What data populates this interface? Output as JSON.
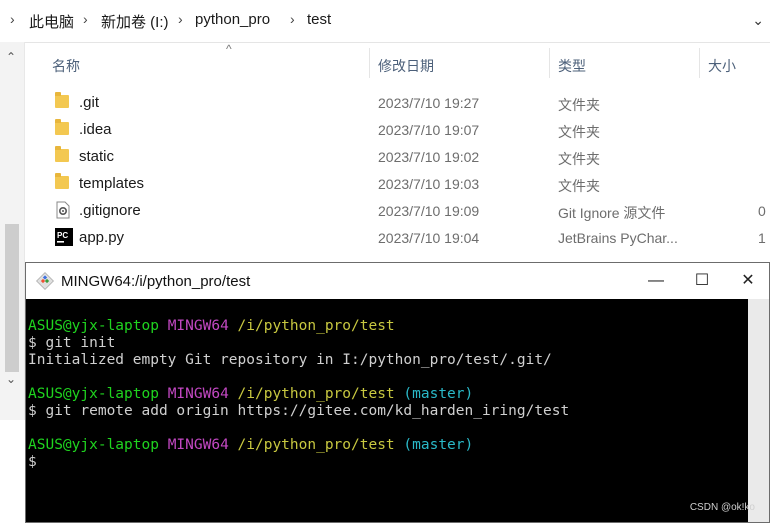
{
  "explorer": {
    "breadcrumb": [
      "此电脑",
      "新加卷 (I:)",
      "python_pro",
      "test"
    ],
    "columns": {
      "name": "名称",
      "modified": "修改日期",
      "type": "类型",
      "size": "大小"
    },
    "files": [
      {
        "name": ".git",
        "icon": "folder-icon",
        "modified": "2023/7/10 19:27",
        "type": "文件夹",
        "size": ""
      },
      {
        "name": ".idea",
        "icon": "folder-icon",
        "modified": "2023/7/10 19:07",
        "type": "文件夹",
        "size": ""
      },
      {
        "name": "static",
        "icon": "folder-icon",
        "modified": "2023/7/10 19:02",
        "type": "文件夹",
        "size": ""
      },
      {
        "name": "templates",
        "icon": "folder-icon",
        "modified": "2023/7/10 19:03",
        "type": "文件夹",
        "size": ""
      },
      {
        "name": ".gitignore",
        "icon": "gear-file-icon",
        "modified": "2023/7/10 19:09",
        "type": "Git Ignore 源文件",
        "size": "0"
      },
      {
        "name": "app.py",
        "icon": "pycharm-icon",
        "modified": "2023/7/10 19:04",
        "type": "JetBrains PyChar...",
        "size": "1"
      }
    ]
  },
  "terminal": {
    "title": "MINGW64:/i/python_pro/test",
    "buttons": {
      "minimize": "—",
      "maximize": "☐",
      "close": "✕"
    },
    "prompt1": {
      "user": "ASUS@yjx-laptop",
      "env": "MINGW64",
      "path": "/i/python_pro/test",
      "branch": ""
    },
    "cmd1": "$ git init",
    "out1": "Initialized empty Git repository in I:/python_pro/test/.git/",
    "prompt2": {
      "user": "ASUS@yjx-laptop",
      "env": "MINGW64",
      "path": "/i/python_pro/test",
      "branch": "(master)"
    },
    "cmd2": "$ git remote add origin https://gitee.com/kd_harden_iring/test",
    "prompt3": {
      "user": "ASUS@yjx-laptop",
      "env": "MINGW64",
      "path": "/i/python_pro/test",
      "branch": "(master)"
    },
    "cursor": "$"
  },
  "colors": {
    "user": "#1fd41f",
    "env": "#c248c2",
    "path": "#c8c840",
    "branch": "#2ab9c8"
  },
  "watermark": "CSDN @ok!ko"
}
